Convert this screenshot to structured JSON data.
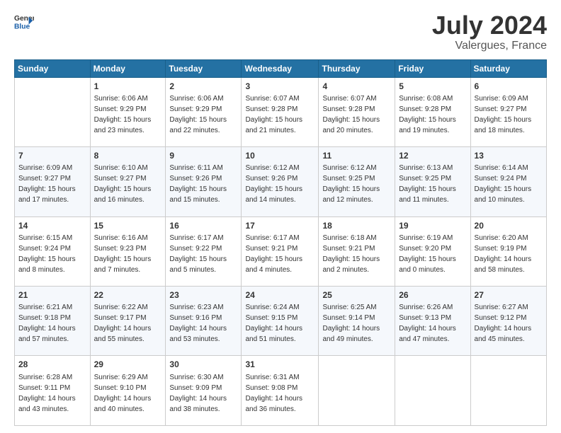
{
  "logo": {
    "text1": "General",
    "text2": "Blue"
  },
  "header": {
    "month": "July 2024",
    "location": "Valergues, France"
  },
  "columns": [
    "Sunday",
    "Monday",
    "Tuesday",
    "Wednesday",
    "Thursday",
    "Friday",
    "Saturday"
  ],
  "weeks": [
    [
      {
        "day": "",
        "sunrise": "",
        "sunset": "",
        "daylight": ""
      },
      {
        "day": "1",
        "sunrise": "Sunrise: 6:06 AM",
        "sunset": "Sunset: 9:29 PM",
        "daylight": "Daylight: 15 hours and 23 minutes."
      },
      {
        "day": "2",
        "sunrise": "Sunrise: 6:06 AM",
        "sunset": "Sunset: 9:29 PM",
        "daylight": "Daylight: 15 hours and 22 minutes."
      },
      {
        "day": "3",
        "sunrise": "Sunrise: 6:07 AM",
        "sunset": "Sunset: 9:28 PM",
        "daylight": "Daylight: 15 hours and 21 minutes."
      },
      {
        "day": "4",
        "sunrise": "Sunrise: 6:07 AM",
        "sunset": "Sunset: 9:28 PM",
        "daylight": "Daylight: 15 hours and 20 minutes."
      },
      {
        "day": "5",
        "sunrise": "Sunrise: 6:08 AM",
        "sunset": "Sunset: 9:28 PM",
        "daylight": "Daylight: 15 hours and 19 minutes."
      },
      {
        "day": "6",
        "sunrise": "Sunrise: 6:09 AM",
        "sunset": "Sunset: 9:27 PM",
        "daylight": "Daylight: 15 hours and 18 minutes."
      }
    ],
    [
      {
        "day": "7",
        "sunrise": "Sunrise: 6:09 AM",
        "sunset": "Sunset: 9:27 PM",
        "daylight": "Daylight: 15 hours and 17 minutes."
      },
      {
        "day": "8",
        "sunrise": "Sunrise: 6:10 AM",
        "sunset": "Sunset: 9:27 PM",
        "daylight": "Daylight: 15 hours and 16 minutes."
      },
      {
        "day": "9",
        "sunrise": "Sunrise: 6:11 AM",
        "sunset": "Sunset: 9:26 PM",
        "daylight": "Daylight: 15 hours and 15 minutes."
      },
      {
        "day": "10",
        "sunrise": "Sunrise: 6:12 AM",
        "sunset": "Sunset: 9:26 PM",
        "daylight": "Daylight: 15 hours and 14 minutes."
      },
      {
        "day": "11",
        "sunrise": "Sunrise: 6:12 AM",
        "sunset": "Sunset: 9:25 PM",
        "daylight": "Daylight: 15 hours and 12 minutes."
      },
      {
        "day": "12",
        "sunrise": "Sunrise: 6:13 AM",
        "sunset": "Sunset: 9:25 PM",
        "daylight": "Daylight: 15 hours and 11 minutes."
      },
      {
        "day": "13",
        "sunrise": "Sunrise: 6:14 AM",
        "sunset": "Sunset: 9:24 PM",
        "daylight": "Daylight: 15 hours and 10 minutes."
      }
    ],
    [
      {
        "day": "14",
        "sunrise": "Sunrise: 6:15 AM",
        "sunset": "Sunset: 9:24 PM",
        "daylight": "Daylight: 15 hours and 8 minutes."
      },
      {
        "day": "15",
        "sunrise": "Sunrise: 6:16 AM",
        "sunset": "Sunset: 9:23 PM",
        "daylight": "Daylight: 15 hours and 7 minutes."
      },
      {
        "day": "16",
        "sunrise": "Sunrise: 6:17 AM",
        "sunset": "Sunset: 9:22 PM",
        "daylight": "Daylight: 15 hours and 5 minutes."
      },
      {
        "day": "17",
        "sunrise": "Sunrise: 6:17 AM",
        "sunset": "Sunset: 9:21 PM",
        "daylight": "Daylight: 15 hours and 4 minutes."
      },
      {
        "day": "18",
        "sunrise": "Sunrise: 6:18 AM",
        "sunset": "Sunset: 9:21 PM",
        "daylight": "Daylight: 15 hours and 2 minutes."
      },
      {
        "day": "19",
        "sunrise": "Sunrise: 6:19 AM",
        "sunset": "Sunset: 9:20 PM",
        "daylight": "Daylight: 15 hours and 0 minutes."
      },
      {
        "day": "20",
        "sunrise": "Sunrise: 6:20 AM",
        "sunset": "Sunset: 9:19 PM",
        "daylight": "Daylight: 14 hours and 58 minutes."
      }
    ],
    [
      {
        "day": "21",
        "sunrise": "Sunrise: 6:21 AM",
        "sunset": "Sunset: 9:18 PM",
        "daylight": "Daylight: 14 hours and 57 minutes."
      },
      {
        "day": "22",
        "sunrise": "Sunrise: 6:22 AM",
        "sunset": "Sunset: 9:17 PM",
        "daylight": "Daylight: 14 hours and 55 minutes."
      },
      {
        "day": "23",
        "sunrise": "Sunrise: 6:23 AM",
        "sunset": "Sunset: 9:16 PM",
        "daylight": "Daylight: 14 hours and 53 minutes."
      },
      {
        "day": "24",
        "sunrise": "Sunrise: 6:24 AM",
        "sunset": "Sunset: 9:15 PM",
        "daylight": "Daylight: 14 hours and 51 minutes."
      },
      {
        "day": "25",
        "sunrise": "Sunrise: 6:25 AM",
        "sunset": "Sunset: 9:14 PM",
        "daylight": "Daylight: 14 hours and 49 minutes."
      },
      {
        "day": "26",
        "sunrise": "Sunrise: 6:26 AM",
        "sunset": "Sunset: 9:13 PM",
        "daylight": "Daylight: 14 hours and 47 minutes."
      },
      {
        "day": "27",
        "sunrise": "Sunrise: 6:27 AM",
        "sunset": "Sunset: 9:12 PM",
        "daylight": "Daylight: 14 hours and 45 minutes."
      }
    ],
    [
      {
        "day": "28",
        "sunrise": "Sunrise: 6:28 AM",
        "sunset": "Sunset: 9:11 PM",
        "daylight": "Daylight: 14 hours and 43 minutes."
      },
      {
        "day": "29",
        "sunrise": "Sunrise: 6:29 AM",
        "sunset": "Sunset: 9:10 PM",
        "daylight": "Daylight: 14 hours and 40 minutes."
      },
      {
        "day": "30",
        "sunrise": "Sunrise: 6:30 AM",
        "sunset": "Sunset: 9:09 PM",
        "daylight": "Daylight: 14 hours and 38 minutes."
      },
      {
        "day": "31",
        "sunrise": "Sunrise: 6:31 AM",
        "sunset": "Sunset: 9:08 PM",
        "daylight": "Daylight: 14 hours and 36 minutes."
      },
      {
        "day": "",
        "sunrise": "",
        "sunset": "",
        "daylight": ""
      },
      {
        "day": "",
        "sunrise": "",
        "sunset": "",
        "daylight": ""
      },
      {
        "day": "",
        "sunrise": "",
        "sunset": "",
        "daylight": ""
      }
    ]
  ]
}
